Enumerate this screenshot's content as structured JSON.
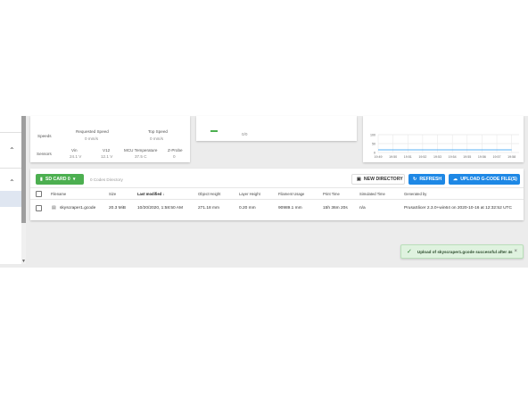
{
  "status": {
    "speeds_label": "Speeds",
    "requested_speed_label": "Requested Speed",
    "requested_speed_value": "0 mm/s",
    "top_speed_label": "Top Speed",
    "top_speed_value": "0 mm/s",
    "sensors_label": "Sensors",
    "vin_label": "Vin",
    "vin_value": "24.1 V",
    "v12_label": "V12",
    "v12_value": "12.1 V",
    "mcu_temp_label": "MCU Temperature",
    "mcu_temp_value": "37.5 C",
    "zprobe_label": "Z-Probe",
    "zprobe_value": "0",
    "partial_value": "0/0"
  },
  "chart_data": {
    "type": "line",
    "x": [
      "19:49",
      "19:50",
      "19:51",
      "19:52",
      "19:53",
      "19:54",
      "19:55",
      "19:56",
      "19:57",
      "19:58"
    ],
    "series": [
      {
        "values": [
          15,
          15,
          15,
          15,
          15,
          15,
          15,
          15,
          15,
          15
        ]
      }
    ],
    "yticks": [
      "100",
      "50",
      "0"
    ],
    "ylim": [
      0,
      100
    ],
    "grid": true
  },
  "toolbar": {
    "sd_card_label": "SD CARD 0",
    "directory_info": "0 Codes Directory",
    "new_dir_label": "NEW DIRECTORY",
    "refresh_label": "REFRESH",
    "upload_label": "UPLOAD G-CODE FILE(S)",
    "accent": "#1976d2",
    "sd_color": "#4caf50"
  },
  "table": {
    "headers": [
      "Filename",
      "Size",
      "Last modified",
      "Object Height",
      "Layer Height",
      "Filament Usage",
      "Print Time",
      "Simulated Time",
      "Generated by"
    ],
    "rows": [
      [
        "skyscraper1.gcode",
        "20.3 MiB",
        "10/20/2020, 1:58:50 AM",
        "271.18 mm",
        "0.20 mm",
        "90989.1 mm",
        "15h 36m 20s",
        "n/a",
        "PrusaSlicer 2.3.0+win64 on 2020-10-16 at 12:32:52 UTC"
      ]
    ]
  },
  "toast": {
    "message": "Upload of skyscraper1.gcode successful after 4s",
    "close": "×"
  }
}
